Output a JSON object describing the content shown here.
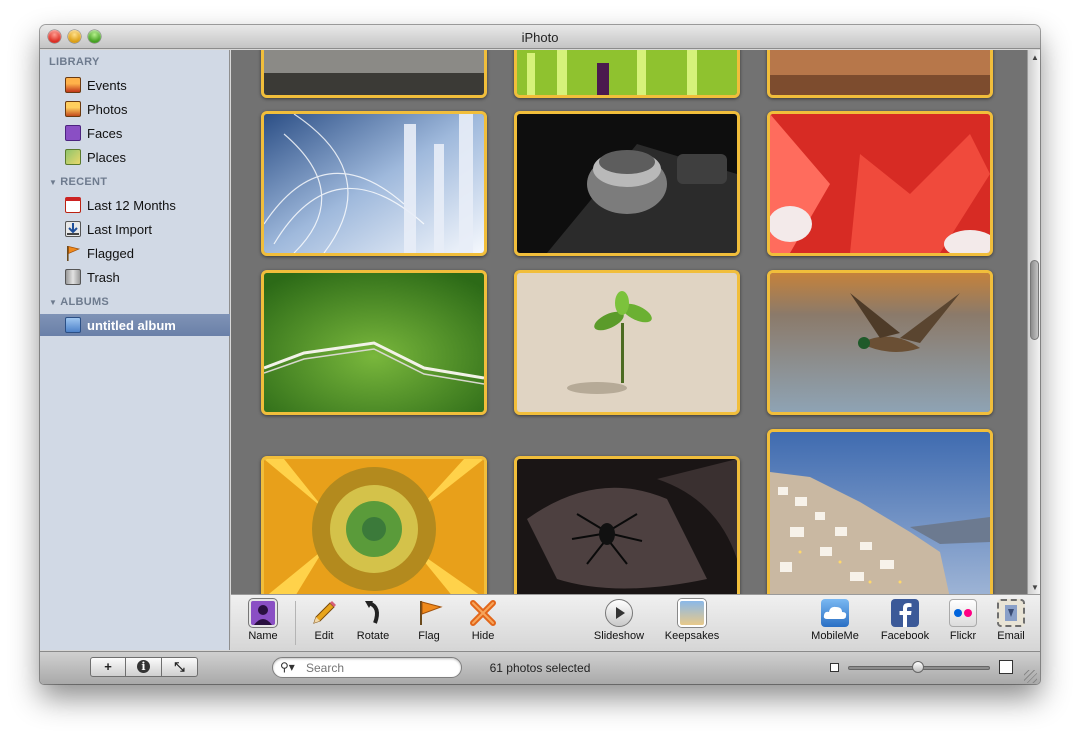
{
  "window": {
    "title": "iPhoto"
  },
  "sidebar": {
    "library_header": "LIBRARY",
    "library_items": [
      {
        "label": "Events",
        "icon": "events-icon"
      },
      {
        "label": "Photos",
        "icon": "photos-icon"
      },
      {
        "label": "Faces",
        "icon": "faces-icon"
      },
      {
        "label": "Places",
        "icon": "places-icon"
      }
    ],
    "recent_header": "RECENT",
    "recent_items": [
      {
        "label": "Last 12 Months",
        "icon": "calendar-icon"
      },
      {
        "label": "Last Import",
        "icon": "import-icon"
      },
      {
        "label": "Flagged",
        "icon": "flag-icon"
      },
      {
        "label": "Trash",
        "icon": "trash-icon"
      }
    ],
    "albums_header": "ALBUMS",
    "album_items": [
      {
        "label": "untitled album",
        "icon": "album-icon",
        "selected": true
      }
    ]
  },
  "toolbar": {
    "name": "Name",
    "edit": "Edit",
    "rotate": "Rotate",
    "flag": "Flag",
    "hide": "Hide",
    "slideshow": "Slideshow",
    "keepsakes": "Keepsakes",
    "mobileme": "MobileMe",
    "facebook": "Facebook",
    "flickr": "Flickr",
    "email": "Email"
  },
  "statusbar": {
    "add": "+",
    "info": "i",
    "fullscreen": "⤡",
    "search_placeholder": "Search",
    "photos_selected": "61 photos selected"
  },
  "colors": {
    "selection_border": "#f1be3b",
    "sidebar_bg": "#d1d9e5",
    "viewer_bg": "#727272"
  }
}
